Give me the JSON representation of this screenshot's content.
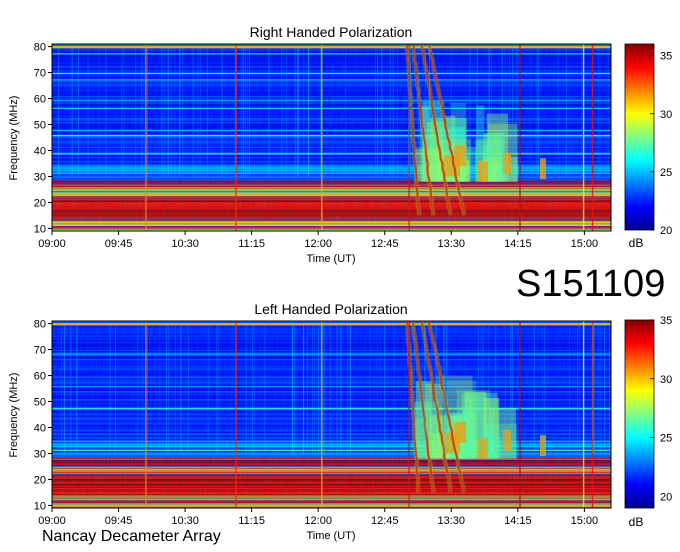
{
  "event_id": "S151109",
  "instrument": "Nancay Decameter Array",
  "scale": {
    "colormap": [
      "#00008f",
      "#0000ff",
      "#0080ff",
      "#00ffff",
      "#80ff80",
      "#ffff00",
      "#ff8000",
      "#ff0000",
      "#800000"
    ]
  },
  "chart_data": [
    {
      "type": "heatmap",
      "title": "Right Handed Polarization",
      "xlabel": "Time (UT)",
      "ylabel": "Frequency (MHz)",
      "x_ticks": [
        "09:00",
        "09:45",
        "10:30",
        "11:15",
        "12:00",
        "12:45",
        "13:30",
        "14:15",
        "15:00"
      ],
      "xlim_minutes": [
        540,
        918
      ],
      "y_ticks": [
        10,
        20,
        30,
        40,
        50,
        60,
        70,
        80
      ],
      "ylim": [
        9,
        81
      ],
      "colorbar_label": "dB",
      "colorbar_ticks": [
        20,
        25,
        30,
        35
      ],
      "colorbar_range": [
        20,
        36
      ],
      "grid": false
    },
    {
      "type": "heatmap",
      "title": "Left Handed Polarization",
      "xlabel": "Time (UT)",
      "ylabel": "Frequency (MHz)",
      "x_ticks": [
        "09:00",
        "09:45",
        "10:30",
        "11:15",
        "12:00",
        "12:45",
        "13:30",
        "14:15",
        "15:00"
      ],
      "xlim_minutes": [
        540,
        918
      ],
      "y_ticks": [
        10,
        20,
        30,
        40,
        50,
        60,
        70,
        80
      ],
      "ylim": [
        9,
        81
      ],
      "colorbar_label": "dB",
      "colorbar_ticks": [
        20,
        25,
        30,
        35
      ],
      "colorbar_range": [
        19,
        35
      ],
      "grid": false
    }
  ]
}
